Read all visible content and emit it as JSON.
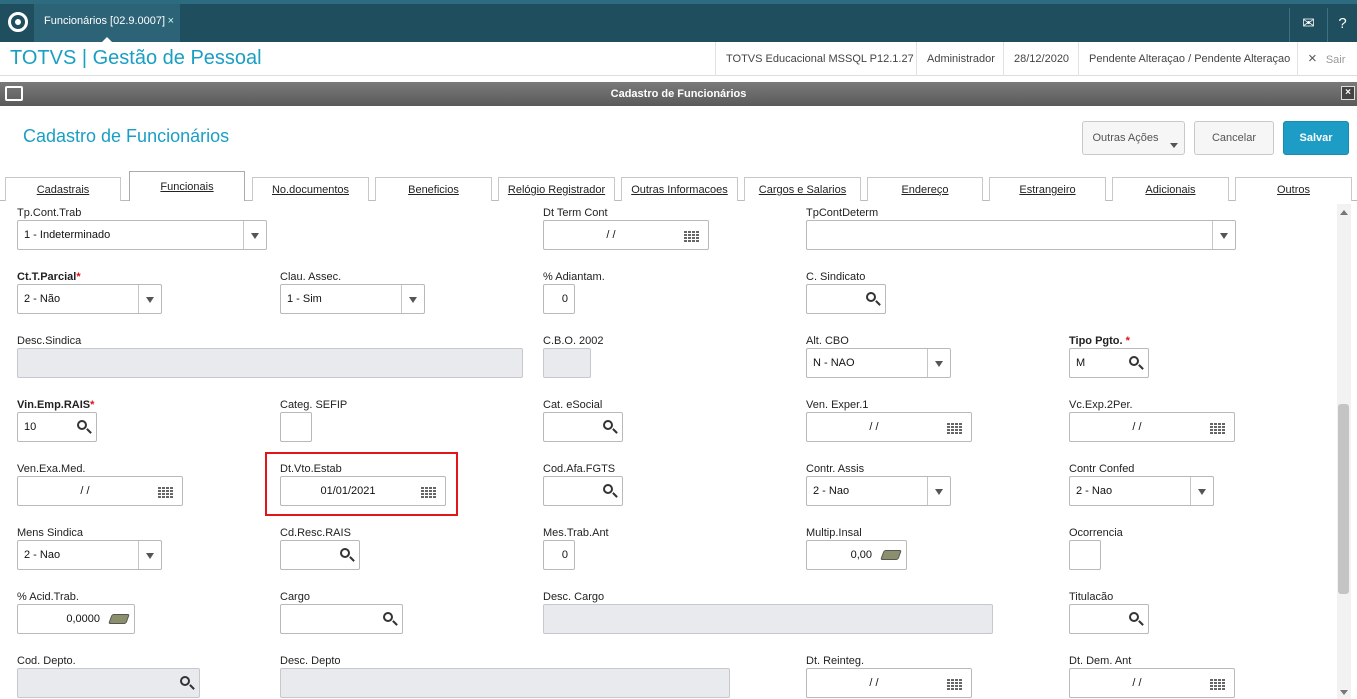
{
  "app": {
    "tab_label": "Funcionários [02.9.0007]",
    "tab_close": "×",
    "brand": "TOTVS | Gestão de Pessoal",
    "env": "TOTVS Educacional MSSQL P12.1.27",
    "user": "Administrador",
    "date": "28/12/2020",
    "status": "Pendente Alteraçao / Pendente Alteraçao",
    "exit_icon": "×",
    "exit_label": "Sair",
    "mail_icon": "✉",
    "help_icon": "?"
  },
  "window": {
    "title": "Cadastro de Funcionários",
    "close": "×"
  },
  "form": {
    "title": "Cadastro de Funcionários",
    "buttons": {
      "outras": "Outras Ações",
      "cancelar": "Cancelar",
      "salvar": "Salvar"
    }
  },
  "tabs": [
    "Cadastrais",
    "Funcionais",
    "No.documentos",
    "Beneficios",
    "Relógio Registrador",
    "Outras Informacoes",
    "Cargos e Salarios",
    "Endereço",
    "Estrangeiro",
    "Adicionais",
    "Outros"
  ],
  "active_tab": "Funcionais",
  "fields": {
    "tp_cont_trab": {
      "label": "Tp.Cont.Trab",
      "value": "1 - Indeterminado"
    },
    "dt_term_cont": {
      "label": "Dt Term Cont",
      "value": "/ /"
    },
    "tp_cont_determ": {
      "label": "TpContDeterm",
      "value": ""
    },
    "ct_t_parcial": {
      "label": "Ct.T.Parcial",
      "value": "2 - Não",
      "required": "*"
    },
    "clau_assec": {
      "label": "Clau. Assec.",
      "value": "1 - Sim"
    },
    "pct_adiantam": {
      "label": "% Adiantam.",
      "value": "0"
    },
    "c_sindicato": {
      "label": "C. Sindicato",
      "value": ""
    },
    "desc_sindica": {
      "label": "Desc.Sindica",
      "value": ""
    },
    "cbo_2002": {
      "label": "C.B.O. 2002",
      "value": ""
    },
    "alt_cbo": {
      "label": "Alt. CBO",
      "value": "N - NAO"
    },
    "tipo_pgto": {
      "label": "Tipo Pgto.",
      "value": "M",
      "required": "*"
    },
    "vin_emp_rais": {
      "label": "Vin.Emp.RAIS",
      "value": "10",
      "required": "*"
    },
    "categ_sefip": {
      "label": "Categ. SEFIP",
      "value": ""
    },
    "cat_esocial": {
      "label": "Cat. eSocial",
      "value": ""
    },
    "ven_exper1": {
      "label": "Ven. Exper.1",
      "value": "/ /"
    },
    "vc_exp_2per": {
      "label": "Vc.Exp.2Per.",
      "value": "/ /"
    },
    "ven_exa_med": {
      "label": "Ven.Exa.Med.",
      "value": "/ /"
    },
    "dt_vto_estab": {
      "label": "Dt.Vto.Estab",
      "value": "01/01/2021"
    },
    "cod_afa_fgts": {
      "label": "Cod.Afa.FGTS",
      "value": ""
    },
    "contr_assis": {
      "label": "Contr. Assis",
      "value": "2 - Nao"
    },
    "contr_confed": {
      "label": "Contr Confed",
      "value": "2 - Nao"
    },
    "mens_sindica": {
      "label": "Mens Sindica",
      "value": "2 - Nao"
    },
    "cd_resc_rais": {
      "label": "Cd.Resc.RAIS",
      "value": ""
    },
    "mes_trab_ant": {
      "label": "Mes.Trab.Ant",
      "value": "0"
    },
    "multip_insal": {
      "label": "Multip.Insal",
      "value": "0,00"
    },
    "ocorrencia": {
      "label": "Ocorrencia",
      "value": ""
    },
    "pct_acid_trab": {
      "label": "% Acid.Trab.",
      "value": "0,0000"
    },
    "cargo": {
      "label": "Cargo",
      "value": ""
    },
    "desc_cargo": {
      "label": "Desc. Cargo",
      "value": ""
    },
    "titulacao": {
      "label": "Titulacão",
      "value": ""
    },
    "cod_depto": {
      "label": "Cod. Depto.",
      "value": ""
    },
    "desc_depto": {
      "label": "Desc. Depto",
      "value": ""
    },
    "dt_reinteg": {
      "label": "Dt. Reinteg.",
      "value": "/ /"
    },
    "dt_dem_ant": {
      "label": "Dt. Dem. Ant",
      "value": "/ /"
    }
  },
  "colors": {
    "accent": "#1a9fc4",
    "topbar": "#1f4e5f",
    "highlight": "#e0161a",
    "required": "#e01010"
  }
}
